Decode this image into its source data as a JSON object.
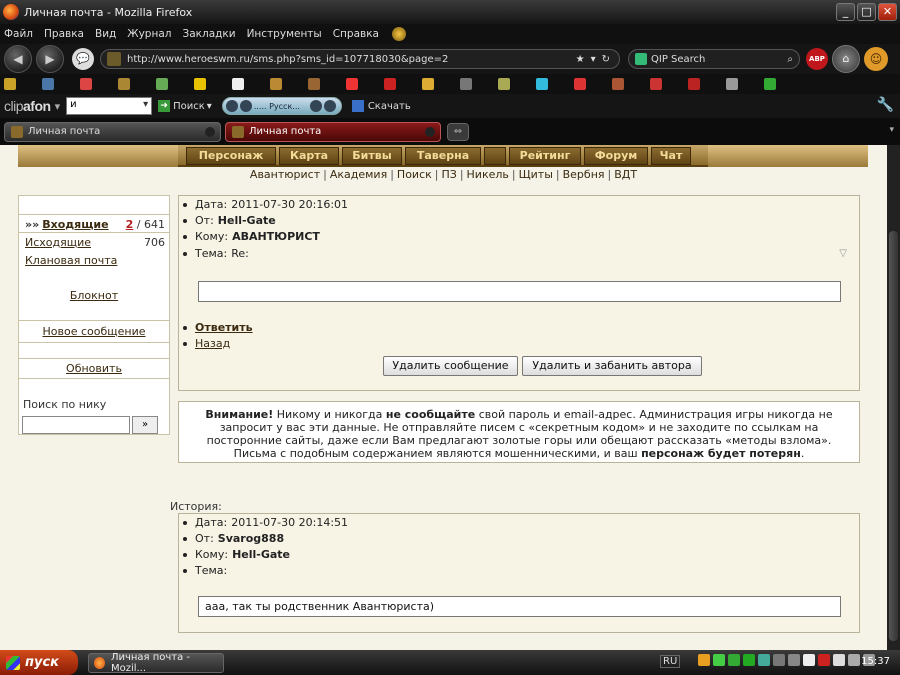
{
  "window": {
    "title": "Личная почта - Mozilla Firefox"
  },
  "menu": [
    "Файл",
    "Правка",
    "Вид",
    "Журнал",
    "Закладки",
    "Инструменты",
    "Справка"
  ],
  "nav": {
    "url": "http://www.heroeswm.ru/sms.php?sms_id=107718030&page=2",
    "search_placeholder": "QIP Search",
    "abp": "ABP"
  },
  "clipbar": {
    "logo_a": "clip",
    "logo_b": "afon",
    "input_value": "и",
    "search_label": "Поиск",
    "player_text": "..... Русск...",
    "download_label": "Скачать"
  },
  "tabs": [
    {
      "label": "Личная почта"
    },
    {
      "label": "Личная почта"
    }
  ],
  "game_menu": [
    "Персонаж",
    "Карта",
    "Битвы",
    "Таверна",
    "",
    "Рейтинг",
    "Форум",
    "Чат"
  ],
  "sublinks": [
    "Авантюрист",
    "Академия",
    "Поиск",
    "ПЗ",
    "Никель",
    "Щиты",
    "Вербня",
    "ВДТ"
  ],
  "sidebar": {
    "inbox_label": "Входящие",
    "inbox_unread": "2",
    "inbox_total": "/ 641",
    "outbox_label": "Исходящие",
    "outbox_count": "706",
    "clan_mail": "Клановая почта",
    "notepad": "Блокнот",
    "new_message": "Новое сообщение",
    "refresh": "Обновить",
    "search_label": "Поиск по нику",
    "search_button": "»"
  },
  "message": {
    "date_label": "Дата:",
    "date": "2011-07-30 20:16:01",
    "from_label": "От:",
    "from": "Hell-Gate",
    "to_label": "Кому:",
    "to": "АВАНТЮРИСТ",
    "subject_label": "Тема:",
    "subject": "Re:",
    "body": "",
    "reply": "Ответить",
    "back": "Назад",
    "delete": "Удалить сообщение",
    "delete_ban": "Удалить и забанить автора"
  },
  "warning": {
    "w1": "Внимание!",
    "t1": " Никому и никогда ",
    "w2": "не сообщайте",
    "t2": " свой пароль и email-адрес. Администрация игры никогда не запросит у вас эти данные. Не отправляйте писем с «секретным кодом» и не заходите по ссылкам на посторонние сайты, даже если Вам предлагают золотые горы или обещают рассказать «методы взлома». Письма с подобным содержанием являются мошенническими, и ваш ",
    "w3": "персонаж будет потерян",
    "t3": "."
  },
  "history": {
    "label": "История:",
    "date_label": "Дата:",
    "date": "2011-07-30 20:14:51",
    "from_label": "От:",
    "from": "Svarog888",
    "to_label": "Кому:",
    "to": "Hell-Gate",
    "subject_label": "Тема:",
    "subject": "",
    "body": "ааа, так ты родственник Авантюриста)"
  },
  "taskbar": {
    "start": "пуск",
    "window_item": "Личная почта - Mozil...",
    "lang": "RU",
    "clock": "15:37"
  },
  "colors": {
    "page_bg": "#f5f3e8",
    "link_brown": "#3b2a10",
    "game_gold": "#8c6b2e",
    "tab_active": "#8a1a1a"
  }
}
